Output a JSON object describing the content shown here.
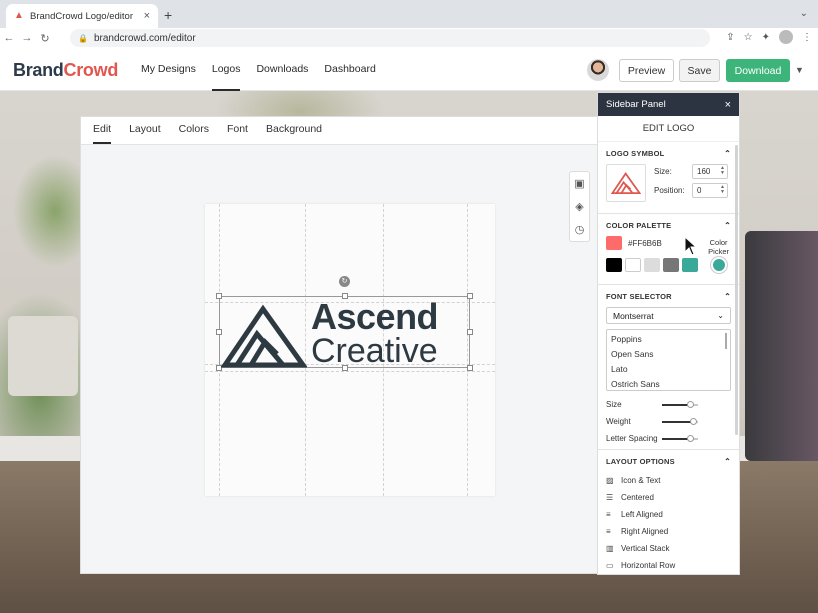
{
  "browser": {
    "tab_title": "BrandCrowd Logo/editor",
    "new_tab": "+",
    "url": "brandcrowd.com/editor"
  },
  "header": {
    "brand_part1": "Brand",
    "brand_part2": "Crowd",
    "nav": [
      "My Designs",
      "Logos",
      "Downloads",
      "Dashboard"
    ],
    "active_nav": "Logos",
    "preview_label": "Preview",
    "save_label": "Save",
    "download_label": "Download"
  },
  "editor": {
    "tabs": [
      "Edit",
      "Layout",
      "Colors",
      "Font",
      "Background"
    ],
    "active_tab": "Edit",
    "logo_line1": "Ascend",
    "logo_line2": "Creative",
    "logo_color": "#2e3a42"
  },
  "sidebar": {
    "title": "Sidebar Panel",
    "subtitle": "EDIT LOGO",
    "logo_symbol": {
      "heading": "LOGO SYMBOL",
      "size_label": "Size:",
      "size_value": "160",
      "position_label": "Position:",
      "position_value": "0"
    },
    "color_palette": {
      "heading": "COLOR PALETTE",
      "primary_hex": "#FF6B6B",
      "picker_label_1": "Color",
      "picker_label_2": "Picker",
      "swatches": [
        "#000000",
        "#ffffff",
        "#dcdcdc",
        "#777777",
        "#3aa99a"
      ],
      "picker_color": "#3aa99a"
    },
    "font_selector": {
      "heading": "FONT SELECTOR",
      "selected": "Montserrat",
      "options": [
        "Poppins",
        "Open Sans",
        "Lato",
        "Ostrich Sans"
      ],
      "size_label": "Size",
      "weight_label": "Weight",
      "spacing_label": "Letter Spacing",
      "size_level": 0.8,
      "weight_level": 0.9,
      "spacing_level": 0.8
    },
    "layout_options": {
      "heading": "LAYOUT OPTIONS",
      "items": [
        "Icon & Text",
        "Centered",
        "Left Aligned",
        "Right Aligned",
        "Vertical Stack",
        "Horizontal Row"
      ]
    }
  }
}
